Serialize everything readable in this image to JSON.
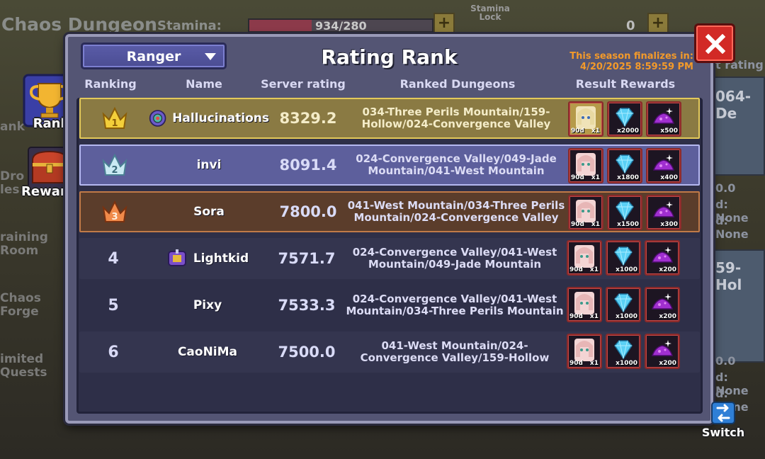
{
  "background": {
    "dungeon_title": "Chaos Dungeon",
    "stamina_label": "Stamina:",
    "stamina_value": "934/280",
    "stamina_fill": 0.34,
    "stamina_lock_label": "Stamina Lock",
    "counter_value": "0",
    "left_labels": [
      "ank",
      "Dro",
      "les:",
      "raining",
      "Room",
      "Chaos",
      "Forge",
      "imited",
      "Quests"
    ],
    "right_labels": [
      "t rating",
      "064-De",
      "0.0",
      "d: None",
      "d: None",
      "59-Hol",
      "0.0",
      "d: None",
      "d: None"
    ]
  },
  "dialog": {
    "title": "Rating Rank",
    "class_select": "Ranger",
    "season_line1": "This season finalizes in:",
    "season_line2": "4/20/2025 8:59:59 PM",
    "headers": {
      "ranking": "Ranking",
      "name": "Name",
      "rating": "Server rating",
      "dungeons": "Ranked Dungeons",
      "rewards": "Result Rewards"
    },
    "rows": [
      {
        "rank": "1",
        "name": "Hallucinations",
        "rating": "8329.2",
        "dungeons": "034-Three Perils Mountain/159-Hollow/024-Convergence Valley",
        "rewards": [
          "x1",
          "x2000",
          "x500"
        ],
        "duration": "90d"
      },
      {
        "rank": "2",
        "name": "invi",
        "rating": "8091.4",
        "dungeons": "024-Convergence Valley/049-Jade Mountain/041-West Mountain",
        "rewards": [
          "x1",
          "x1800",
          "x400"
        ],
        "duration": "90d"
      },
      {
        "rank": "3",
        "name": "Sora",
        "rating": "7800.0",
        "dungeons": "041-West Mountain/034-Three Perils Mountain/024-Convergence Valley",
        "rewards": [
          "x1",
          "x1500",
          "x300"
        ],
        "duration": "90d"
      },
      {
        "rank": "4",
        "name": "Lightkid",
        "rating": "7571.7",
        "dungeons": "024-Convergence Valley/041-West Mountain/049-Jade Mountain",
        "rewards": [
          "x1",
          "x1000",
          "x200"
        ],
        "duration": "90d"
      },
      {
        "rank": "5",
        "name": "Pixy",
        "rating": "7533.3",
        "dungeons": "024-Convergence Valley/041-West Mountain/034-Three Perils Mountain",
        "rewards": [
          "x1",
          "x1000",
          "x200"
        ],
        "duration": "90d"
      },
      {
        "rank": "6",
        "name": "CaoNiMa",
        "rating": "7500.0",
        "dungeons": "041-West Mountain/024-Convergence Valley/159-Hollow",
        "rewards": [
          "x1",
          "x1000",
          "x200"
        ],
        "duration": "90d"
      }
    ]
  },
  "side": {
    "rank_label": "Rank",
    "rewards_label": "Rewards",
    "switch_label": "Switch"
  },
  "colors": {
    "gold_row": "#8a7a43",
    "silver_row": "#5d5f9c",
    "bronze_row": "#5b3d2b",
    "season_text": "#f39a2a",
    "close_button": "#d22a26"
  }
}
